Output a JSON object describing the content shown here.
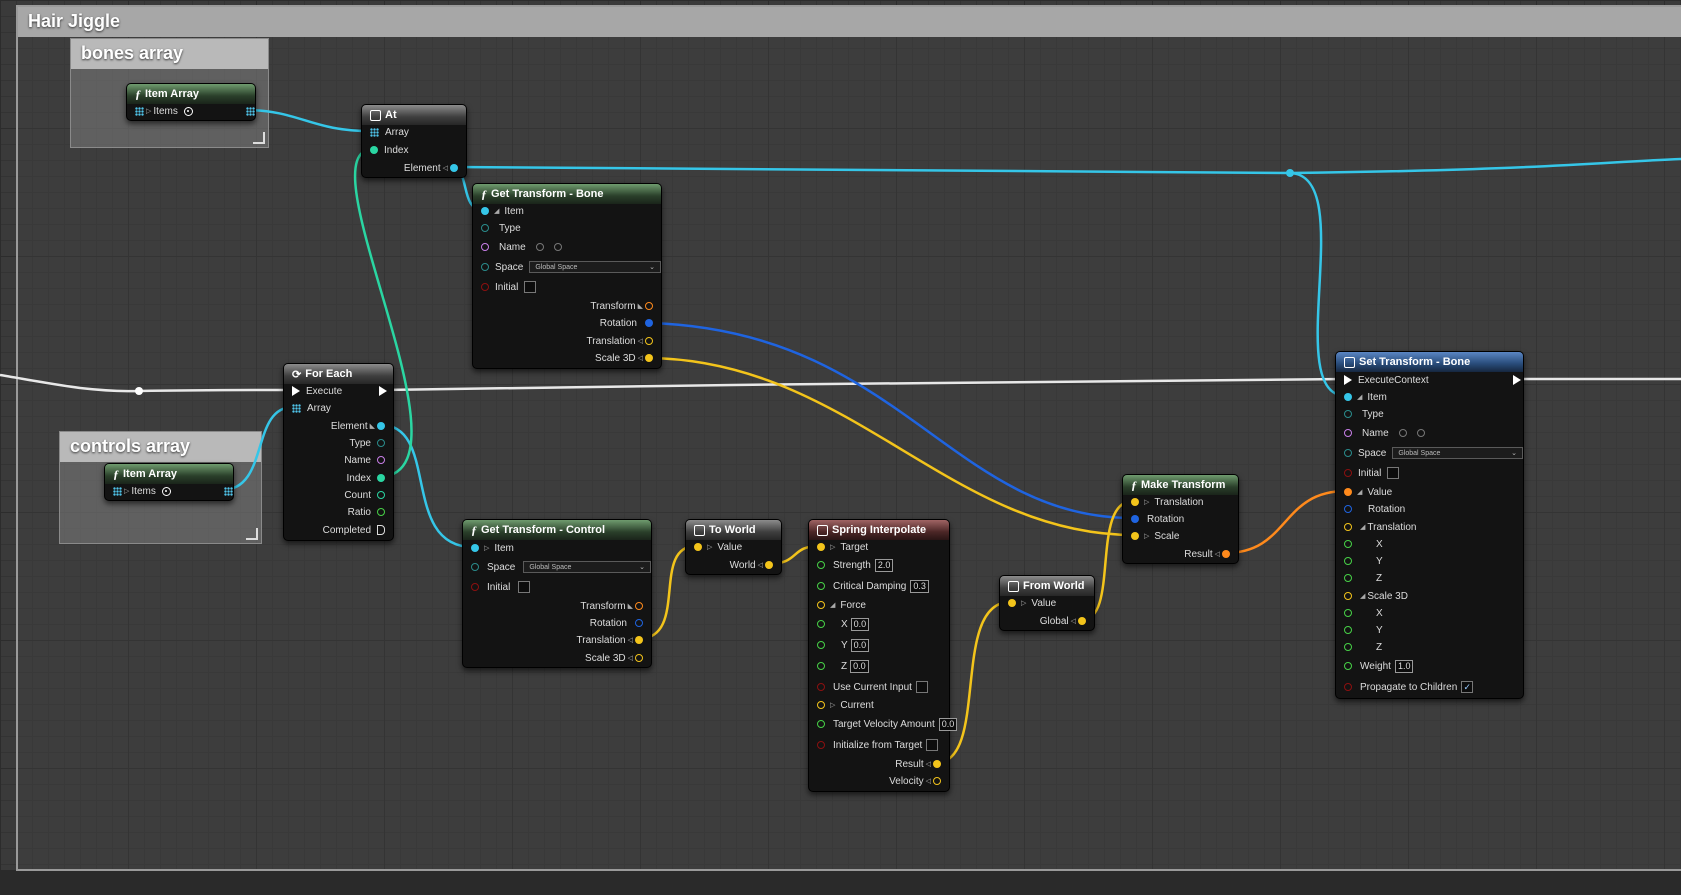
{
  "graph_title": "Hair Jiggle",
  "comments": {
    "bones": "bones array",
    "controls": "controls array"
  },
  "item_array_bones": {
    "title": "Item Array",
    "items": "Items"
  },
  "item_array_controls": {
    "title": "Item Array",
    "items": "Items"
  },
  "at_node": {
    "title": "At",
    "array": "Array",
    "index": "Index",
    "element": "Element"
  },
  "for_each": {
    "title": "For Each",
    "execute": "Execute",
    "array": "Array",
    "element": "Element",
    "type": "Type",
    "name": "Name",
    "index": "Index",
    "count": "Count",
    "ratio": "Ratio",
    "completed": "Completed"
  },
  "get_bone": {
    "title": "Get Transform - Bone",
    "item": "Item",
    "type": "Type",
    "name": "Name",
    "space": "Space",
    "space_value": "Global Space",
    "initial": "Initial",
    "transform": "Transform",
    "rotation": "Rotation",
    "translation": "Translation",
    "scale": "Scale 3D"
  },
  "get_control": {
    "title": "Get Transform - Control",
    "item": "Item",
    "space": "Space",
    "space_value": "Global Space",
    "initial": "Initial",
    "transform": "Transform",
    "rotation": "Rotation",
    "translation": "Translation",
    "scale": "Scale 3D"
  },
  "to_world": {
    "title": "To World",
    "value": "Value",
    "world": "World"
  },
  "spring": {
    "title": "Spring Interpolate",
    "target": "Target",
    "strength": "Strength",
    "strength_value": "2.0",
    "critical_damping": "Critical Damping",
    "critical_damping_value": "0.3",
    "force": "Force",
    "x": "X",
    "x_value": "0.0",
    "y": "Y",
    "y_value": "0.0",
    "z": "Z",
    "z_value": "0.0",
    "use_current_input": "Use Current Input",
    "current": "Current",
    "target_velocity_amount": "Target Velocity Amount",
    "target_velocity_value": "0.0",
    "initialize_from_target": "Initialize from Target",
    "result": "Result",
    "velocity": "Velocity"
  },
  "from_world": {
    "title": "From World",
    "value": "Value",
    "global": "Global"
  },
  "make_transform": {
    "title": "Make Transform",
    "translation": "Translation",
    "rotation": "Rotation",
    "scale": "Scale",
    "result": "Result"
  },
  "set_bone": {
    "title": "Set Transform - Bone",
    "execute_context": "ExecuteContext",
    "item": "Item",
    "type": "Type",
    "name": "Name",
    "space": "Space",
    "space_value": "Global Space",
    "initial": "Initial",
    "value": "Value",
    "rotation": "Rotation",
    "translation": "Translation",
    "x": "X",
    "y": "Y",
    "z": "Z",
    "scale": "Scale 3D",
    "sx": "X",
    "sy": "Y",
    "sz": "Z",
    "weight": "Weight",
    "weight_value": "1.0",
    "propagate": "Propagate to Children"
  },
  "colors": {
    "struct_item": "#35c6e8",
    "transform": "#ff8a1c",
    "rotation": "#1f64e0",
    "vector": "#f3c41b",
    "int": "#2ad6a2",
    "float": "#47d147",
    "name": "#c87fe8",
    "bool": "#8c1010",
    "exec": "#ffffff",
    "type_pin": "#2a8c8c"
  },
  "icons": [
    "function-icon",
    "grid-icon",
    "target-icon",
    "loop-icon",
    "node-icon",
    "magnifier-icon",
    "chevron-down-icon",
    "checkmark-icon"
  ]
}
